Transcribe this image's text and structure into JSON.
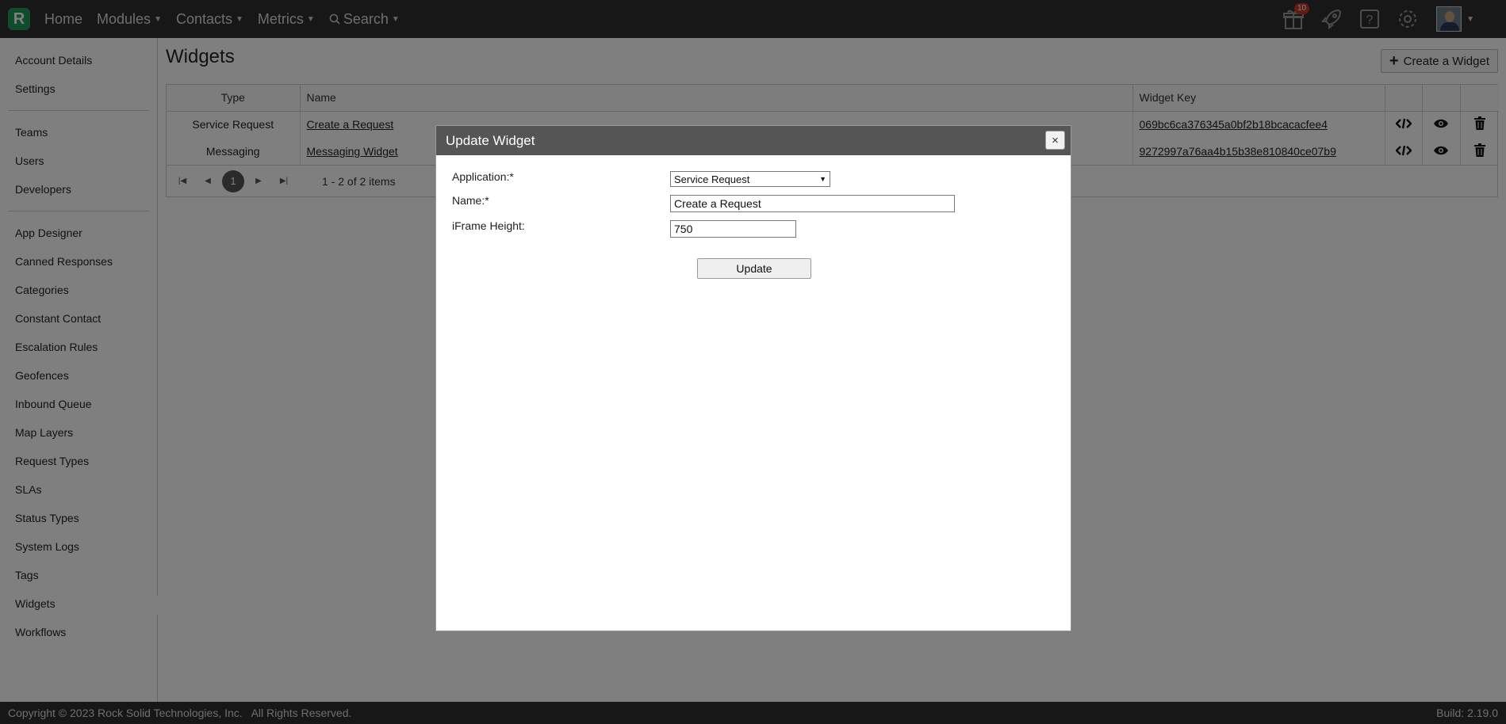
{
  "nav": {
    "home": "Home",
    "modules": "Modules",
    "contacts": "Contacts",
    "metrics": "Metrics",
    "search": "Search",
    "gift_badge": "10",
    "icons": [
      "gift-icon",
      "rocket-icon",
      "help-icon",
      "gear-icon",
      "avatar"
    ]
  },
  "sidebar": {
    "group1": [
      "Account Details",
      "Settings"
    ],
    "group2": [
      "Teams",
      "Users",
      "Developers"
    ],
    "group3": [
      "App Designer",
      "Canned Responses",
      "Categories",
      "Constant Contact",
      "Escalation Rules",
      "Geofences",
      "Inbound Queue",
      "Map Layers",
      "Request Types",
      "SLAs",
      "Status Types",
      "System Logs",
      "Tags",
      "Widgets",
      "Workflows"
    ]
  },
  "page": {
    "title": "Widgets",
    "create_button": "Create a Widget"
  },
  "table": {
    "headers": {
      "type": "Type",
      "name": "Name",
      "key": "Widget Key"
    },
    "rows": [
      {
        "type": "Service Request",
        "name": "Create a Request",
        "key": "069bc6ca376345a0bf2b18bcacacfee4"
      },
      {
        "type": "Messaging",
        "name": "Messaging Widget",
        "key": "9272997a76aa4b15b38e810840ce07b9"
      }
    ],
    "pager": {
      "current_page": "1",
      "info": "1 - 2 of 2 items"
    }
  },
  "modal": {
    "title": "Update Widget",
    "close": "×",
    "application_label": "Application:*",
    "application_value": "Service Request",
    "name_label": "Name:*",
    "name_value": "Create a Request",
    "iframe_label": "iFrame Height:",
    "iframe_value": "750",
    "update_button": "Update"
  },
  "footer": {
    "copyright": "Copyright © 2023 Rock Solid Technologies, Inc.   All Rights Reserved.",
    "build": "Build: 2.19.0"
  },
  "colors": {
    "topbar": "#2e2e2e",
    "logo": "#1f9d5b",
    "badge": "#c0392b",
    "modal_header": "#555555"
  }
}
